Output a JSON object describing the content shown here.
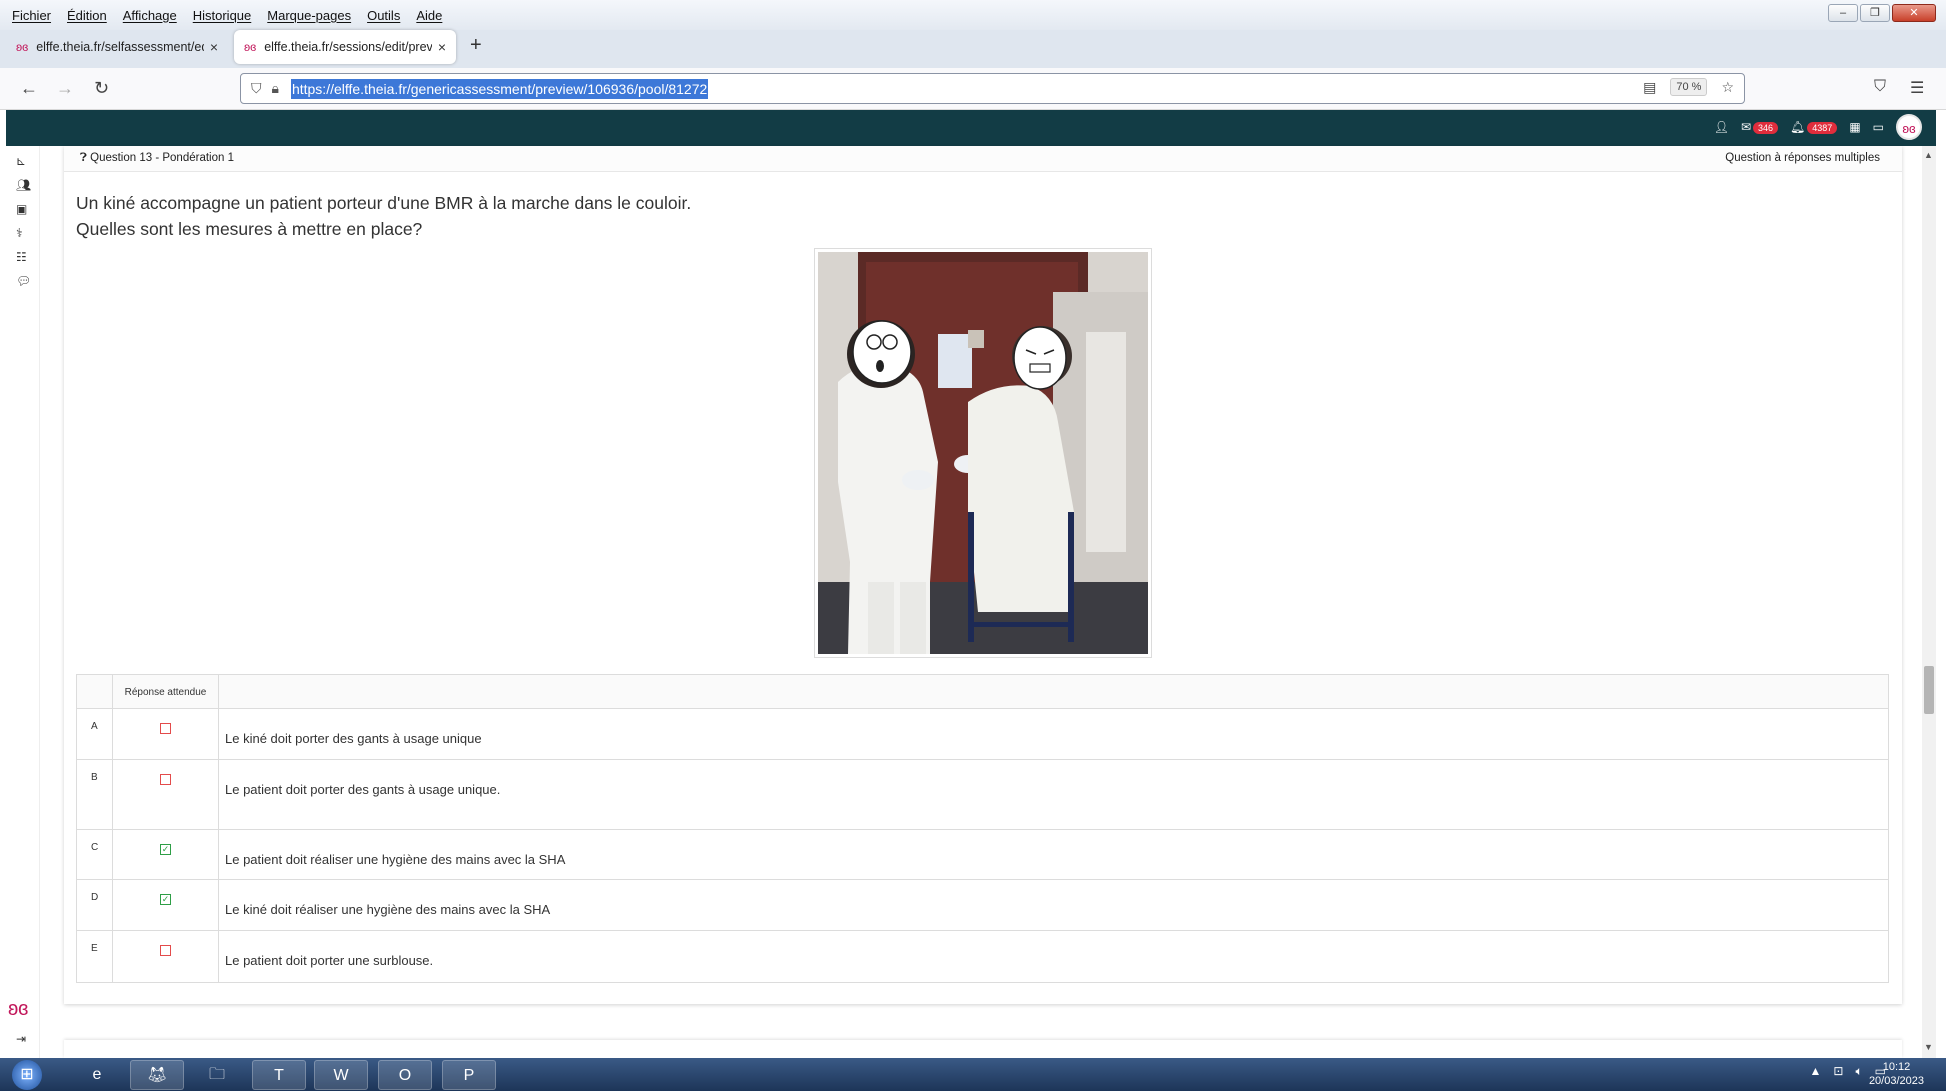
{
  "browser": {
    "menus": [
      "Fichier",
      "Édition",
      "Affichage",
      "Historique",
      "Marque-pages",
      "Outils",
      "Aide"
    ],
    "window_controls": {
      "minimize": "–",
      "restore": "❐",
      "close": "✕"
    },
    "tabs": [
      {
        "label": "elffe.theia.fr/selfassessment/ed",
        "close": "×"
      },
      {
        "label": "elffe.theia.fr/sessions/edit/prev",
        "close": "×"
      }
    ],
    "new_tab": "+",
    "url": "https://elffe.theia.fr/genericassessment/preview/106936/pool/81272",
    "zoom": "70 %"
  },
  "header": {
    "messages_badge": "346",
    "notifications_badge": "4387"
  },
  "question": {
    "title": "Question 13 - Pondération 1",
    "type": "Question à réponses multiples",
    "line1": "Un kiné accompagne un patient porteur d'une BMR à la marche dans le couloir.",
    "line2": "Quelles sont les mesures à mettre en place?",
    "answers_header": "Réponse attendue",
    "answers": [
      {
        "letter": "A",
        "expected": false,
        "text": "Le kiné doit porter des gants à usage unique"
      },
      {
        "letter": "B",
        "expected": false,
        "text": "Le patient doit porter des gants à usage unique."
      },
      {
        "letter": "C",
        "expected": true,
        "text": "Le patient doit réaliser une hygiène des mains avec la SHA"
      },
      {
        "letter": "D",
        "expected": true,
        "text": "Le kiné doit réaliser une hygiène des mains avec la SHA"
      },
      {
        "letter": "E",
        "expected": false,
        "text": "Le patient doit porter une surblouse."
      }
    ]
  },
  "taskbar": {
    "time": "10:12",
    "date": "20/03/2023"
  },
  "colors": {
    "header_bg": "#123c45",
    "checkbox_checked": "#2e9e46",
    "checkbox_unchecked": "#e34b4b",
    "url_highlight": "#3d78d8"
  }
}
